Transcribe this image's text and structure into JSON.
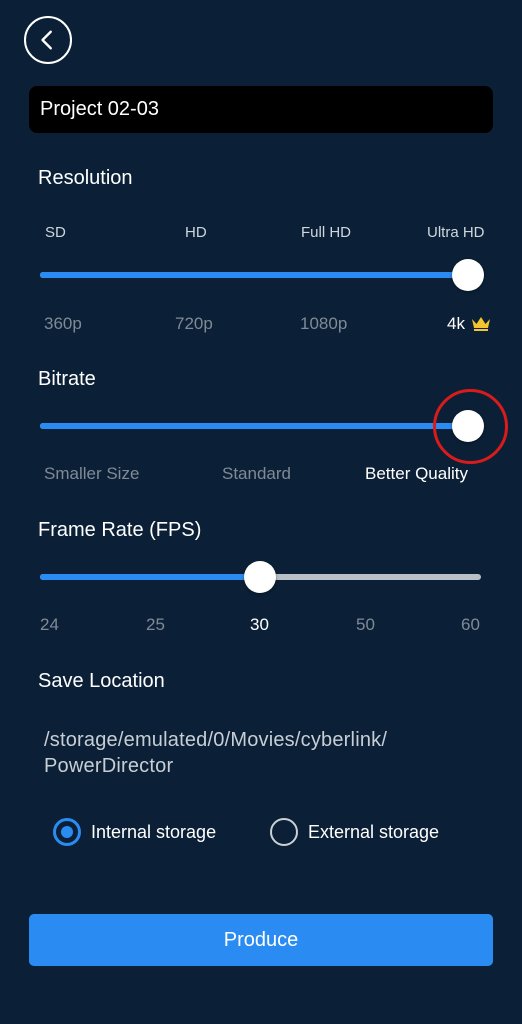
{
  "header": {
    "back_icon": "chevron-left-icon"
  },
  "project": {
    "title": "Project 02-03"
  },
  "resolution": {
    "label": "Resolution",
    "quality_labels": [
      "SD",
      "HD",
      "Full HD",
      "Ultra HD"
    ],
    "values": [
      "360p",
      "720p",
      "1080p",
      "4k"
    ],
    "selected_index": 3,
    "premium_icon": "crown-icon"
  },
  "bitrate": {
    "label": "Bitrate",
    "options": [
      "Smaller Size",
      "Standard",
      "Better Quality"
    ],
    "selected_index": 2
  },
  "frame_rate": {
    "label": "Frame Rate (FPS)",
    "options": [
      "24",
      "25",
      "30",
      "50",
      "60"
    ],
    "selected_index": 2
  },
  "save_location": {
    "label": "Save Location",
    "path": "/storage/emulated/0/Movies/cyberlink/\nPowerDirector",
    "internal_label": "Internal storage",
    "external_label": "External storage",
    "selected": "internal"
  },
  "produce_button": {
    "label": "Produce"
  },
  "colors": {
    "background": "#0b2036",
    "accent": "#2a8cf2",
    "highlight": "#d81b1b",
    "premium": "#f4c430"
  }
}
